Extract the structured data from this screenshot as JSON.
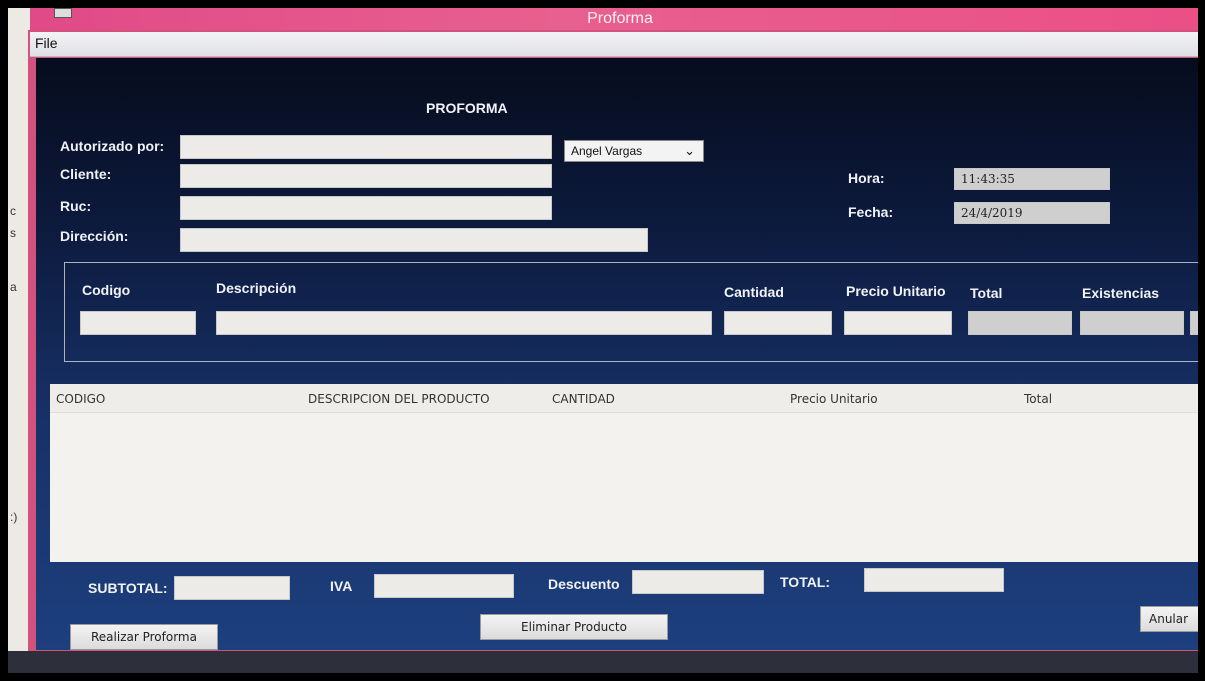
{
  "window": {
    "title": "Proforma"
  },
  "menu": {
    "file": "File"
  },
  "background": {
    "fragments": [
      "c",
      "s",
      "a",
      ":)"
    ]
  },
  "form": {
    "heading": "PROFORMA",
    "autorizado_label": "Autorizado por:",
    "autorizado_value": "",
    "autorizado_select": "Angel Vargas",
    "cliente_label": "Cliente:",
    "cliente_value": "",
    "ruc_label": "Ruc:",
    "ruc_value": "",
    "direccion_label": "Dirección:",
    "direccion_value": "",
    "hora_label": "Hora:",
    "hora_value": "11:43:35",
    "fecha_label": "Fecha:",
    "fecha_value": "24/4/2019"
  },
  "detail": {
    "codigo_label": "Codigo",
    "descripcion_label": "Descripción",
    "cantidad_label": "Cantidad",
    "precio_label": "Precio Unitario",
    "total_label": "Total",
    "existencias_label": "Existencias"
  },
  "table": {
    "columns": [
      "CODIGO",
      "DESCRIPCION DEL PRODUCTO",
      "CANTIDAD",
      "Precio Unitario",
      "Total"
    ],
    "rows": []
  },
  "totals": {
    "subtotal_label": "SUBTOTAL:",
    "iva_label": "IVA",
    "descuento_label": "Descuento",
    "total_label": "TOTAL:"
  },
  "buttons": {
    "realizar": "Realizar Proforma",
    "eliminar": "Eliminar Producto",
    "anular": "Anular Pro"
  }
}
